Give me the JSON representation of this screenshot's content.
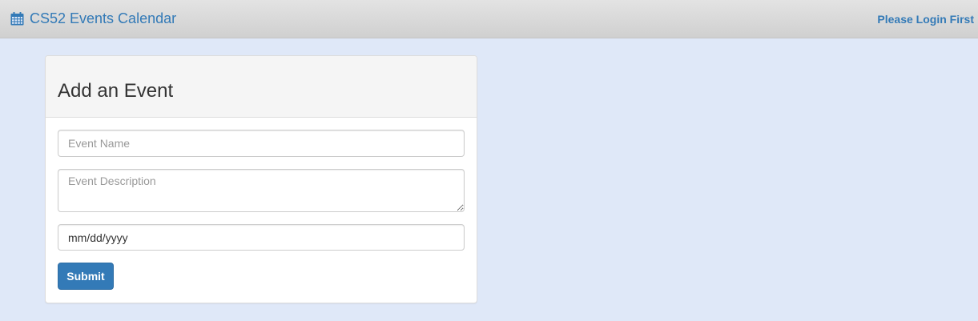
{
  "navbar": {
    "brand_icon": "calendar-icon",
    "brand_label": "CS52 Events Calendar",
    "login_label": "Please Login First",
    "link_color": "#337ab7"
  },
  "form": {
    "title": "Add an Event",
    "event_name_placeholder": "Event Name",
    "event_description_placeholder": "Event Description",
    "event_date_value": "mm/dd/yyyy",
    "submit_label": "Submit",
    "button_color": "#337ab7"
  },
  "page": {
    "background_color": "#dfe8f8"
  }
}
